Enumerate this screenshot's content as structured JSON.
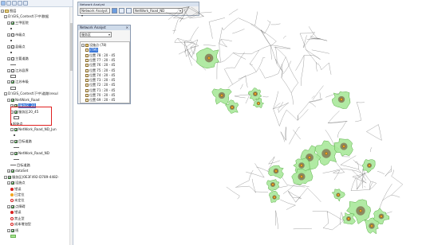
{
  "toc": {
    "items": [
      {
        "indent": 1,
        "exp": "−",
        "chk": "none",
        "icon": "grp",
        "label": "图层",
        "sym": "none"
      },
      {
        "indent": 2,
        "exp": "−",
        "chk": "none",
        "icon": "none",
        "label": "D:\\GIS_Contest\\下中\\数据",
        "sym": "none"
      },
      {
        "indent": 3,
        "exp": "−",
        "chk": "on",
        "icon": "none",
        "label": "三甲医院",
        "sym": "none"
      },
      {
        "indent": 4,
        "exp": "",
        "chk": "none",
        "icon": "none",
        "label": "",
        "sym": "pt"
      },
      {
        "indent": 3,
        "exp": "−",
        "chk": "off",
        "icon": "none",
        "label": "市级点",
        "sym": "none"
      },
      {
        "indent": 4,
        "exp": "",
        "chk": "none",
        "icon": "none",
        "label": "",
        "sym": "pt"
      },
      {
        "indent": 3,
        "exp": "−",
        "chk": "off",
        "icon": "none",
        "label": "县级点",
        "sym": "none"
      },
      {
        "indent": 4,
        "exp": "",
        "chk": "none",
        "icon": "none",
        "label": "",
        "sym": "pt"
      },
      {
        "indent": 3,
        "exp": "−",
        "chk": "off",
        "icon": "none",
        "label": "主要道路",
        "sym": "none"
      },
      {
        "indent": 4,
        "exp": "",
        "chk": "none",
        "icon": "none",
        "label": "",
        "sym": "line"
      },
      {
        "indent": 3,
        "exp": "−",
        "chk": "off",
        "icon": "none",
        "label": "江苏县界",
        "sym": "none"
      },
      {
        "indent": 4,
        "exp": "",
        "chk": "none",
        "icon": "none",
        "label": "",
        "sym": "box"
      },
      {
        "indent": 3,
        "exp": "−",
        "chk": "on",
        "icon": "none",
        "label": "江苏市级",
        "sym": "none"
      },
      {
        "indent": 4,
        "exp": "",
        "chk": "none",
        "icon": "none",
        "label": "",
        "sym": "box"
      },
      {
        "indent": 2,
        "exp": "−",
        "chk": "none",
        "icon": "none",
        "label": "D:\\GIS_Contest\\下中\\道路\\resul",
        "sym": "none"
      },
      {
        "indent": 3,
        "exp": "−",
        "chk": "on",
        "icon": "none",
        "label": "NetWork_Road",
        "sym": "none"
      },
      {
        "indent": 4,
        "exp": "+",
        "chk": "on",
        "icon": "none",
        "label": "服务区_20",
        "sym": "none",
        "selected": true
      },
      {
        "indent": 4,
        "exp": "−",
        "chk": "on",
        "icon": "none",
        "label": "服务区20_45",
        "sym": "none"
      },
      {
        "indent": 5,
        "exp": "",
        "chk": "none",
        "icon": "none",
        "label": "",
        "sym": "box"
      },
      {
        "indent": 4,
        "exp": "",
        "chk": "none",
        "icon": "none",
        "label": "起始点",
        "sym": "pt"
      },
      {
        "indent": 4,
        "exp": "−",
        "chk": "on",
        "icon": "none",
        "label": "NetWork_Road_ND_Jun",
        "sym": "none"
      },
      {
        "indent": 5,
        "exp": "",
        "chk": "none",
        "icon": "none",
        "label": "",
        "sym": "pt"
      },
      {
        "indent": 4,
        "exp": "−",
        "chk": "on",
        "icon": "none",
        "label": "目标道路",
        "sym": "none"
      },
      {
        "indent": 5,
        "exp": "",
        "chk": "none",
        "icon": "none",
        "label": "",
        "sym": "line"
      },
      {
        "indent": 4,
        "exp": "−",
        "chk": "on",
        "icon": "none",
        "label": "NetWork_Road_ND",
        "sym": "none"
      },
      {
        "indent": 5,
        "exp": "",
        "chk": "none",
        "icon": "none",
        "label": "",
        "sym": "line"
      },
      {
        "indent": 4,
        "exp": "",
        "chk": "none",
        "icon": "none",
        "label": "目标道路",
        "sym": "line"
      },
      {
        "indent": 3,
        "exp": "+",
        "chk": "on",
        "icon": "none",
        "label": "dataSet",
        "sym": "none"
      },
      {
        "indent": 2,
        "exp": "−",
        "chk": "on",
        "icon": "none",
        "label": "服务区(0E3F492-D789-4482-",
        "sym": "none"
      },
      {
        "indent": 3,
        "exp": "−",
        "chk": "on",
        "icon": "none",
        "label": "设施点",
        "sym": "none"
      },
      {
        "indent": 4,
        "exp": "",
        "chk": "none",
        "icon": "none",
        "label": "错误",
        "sym": "red"
      },
      {
        "indent": 4,
        "exp": "",
        "chk": "none",
        "icon": "none",
        "label": "已定位",
        "sym": "orange"
      },
      {
        "indent": 4,
        "exp": "",
        "chk": "none",
        "icon": "none",
        "label": "未定位",
        "sym": "redring"
      },
      {
        "indent": 3,
        "exp": "−",
        "chk": "on",
        "icon": "none",
        "label": "点障碍",
        "sym": "none"
      },
      {
        "indent": 4,
        "exp": "",
        "chk": "none",
        "icon": "none",
        "label": "错误",
        "sym": "red"
      },
      {
        "indent": 4,
        "exp": "",
        "chk": "none",
        "icon": "none",
        "label": "禁止型",
        "sym": "redring"
      },
      {
        "indent": 4,
        "exp": "",
        "chk": "none",
        "icon": "none",
        "label": "成本增加型",
        "sym": "redring"
      },
      {
        "indent": 3,
        "exp": "−",
        "chk": "on",
        "icon": "none",
        "label": "线",
        "sym": "none"
      },
      {
        "indent": 4,
        "exp": "",
        "chk": "none",
        "icon": "none",
        "label": "",
        "sym": "green"
      }
    ]
  },
  "na_toolbar": {
    "title": "Network Analyst",
    "analyst_menu": "Network Analyst ▾",
    "dataset": "NetWork_Road_ND"
  },
  "na_window": {
    "title": "Network Analyst",
    "close": "×",
    "layer": "服务区",
    "rows": [
      {
        "type": "group",
        "label": "设施点 (78)"
      },
      {
        "type": "sel",
        "label": "(TM)"
      },
      {
        "type": "item",
        "label": "位置 78 : 20 - 45"
      },
      {
        "type": "item",
        "label": "位置 77 : 20 - 45"
      },
      {
        "type": "item",
        "label": "位置 76 : 20 - 45"
      },
      {
        "type": "item",
        "label": "位置 75 : 20 - 45"
      },
      {
        "type": "item",
        "label": "位置 74 : 20 - 45"
      },
      {
        "type": "item",
        "label": "位置 73 : 20 - 45"
      },
      {
        "type": "item",
        "label": "位置 72 : 20 - 45"
      },
      {
        "type": "item",
        "label": "位置 71 : 20 - 45"
      },
      {
        "type": "item",
        "label": "位置 70 : 20 - 45"
      },
      {
        "type": "item",
        "label": "位置 69 : 20 - 45"
      }
    ]
  },
  "map": {
    "colors": {
      "road": "#4a4a4a",
      "service_area": "#a9e89a",
      "service_area_border": "#5bb048",
      "facility": "#e8a020"
    }
  }
}
